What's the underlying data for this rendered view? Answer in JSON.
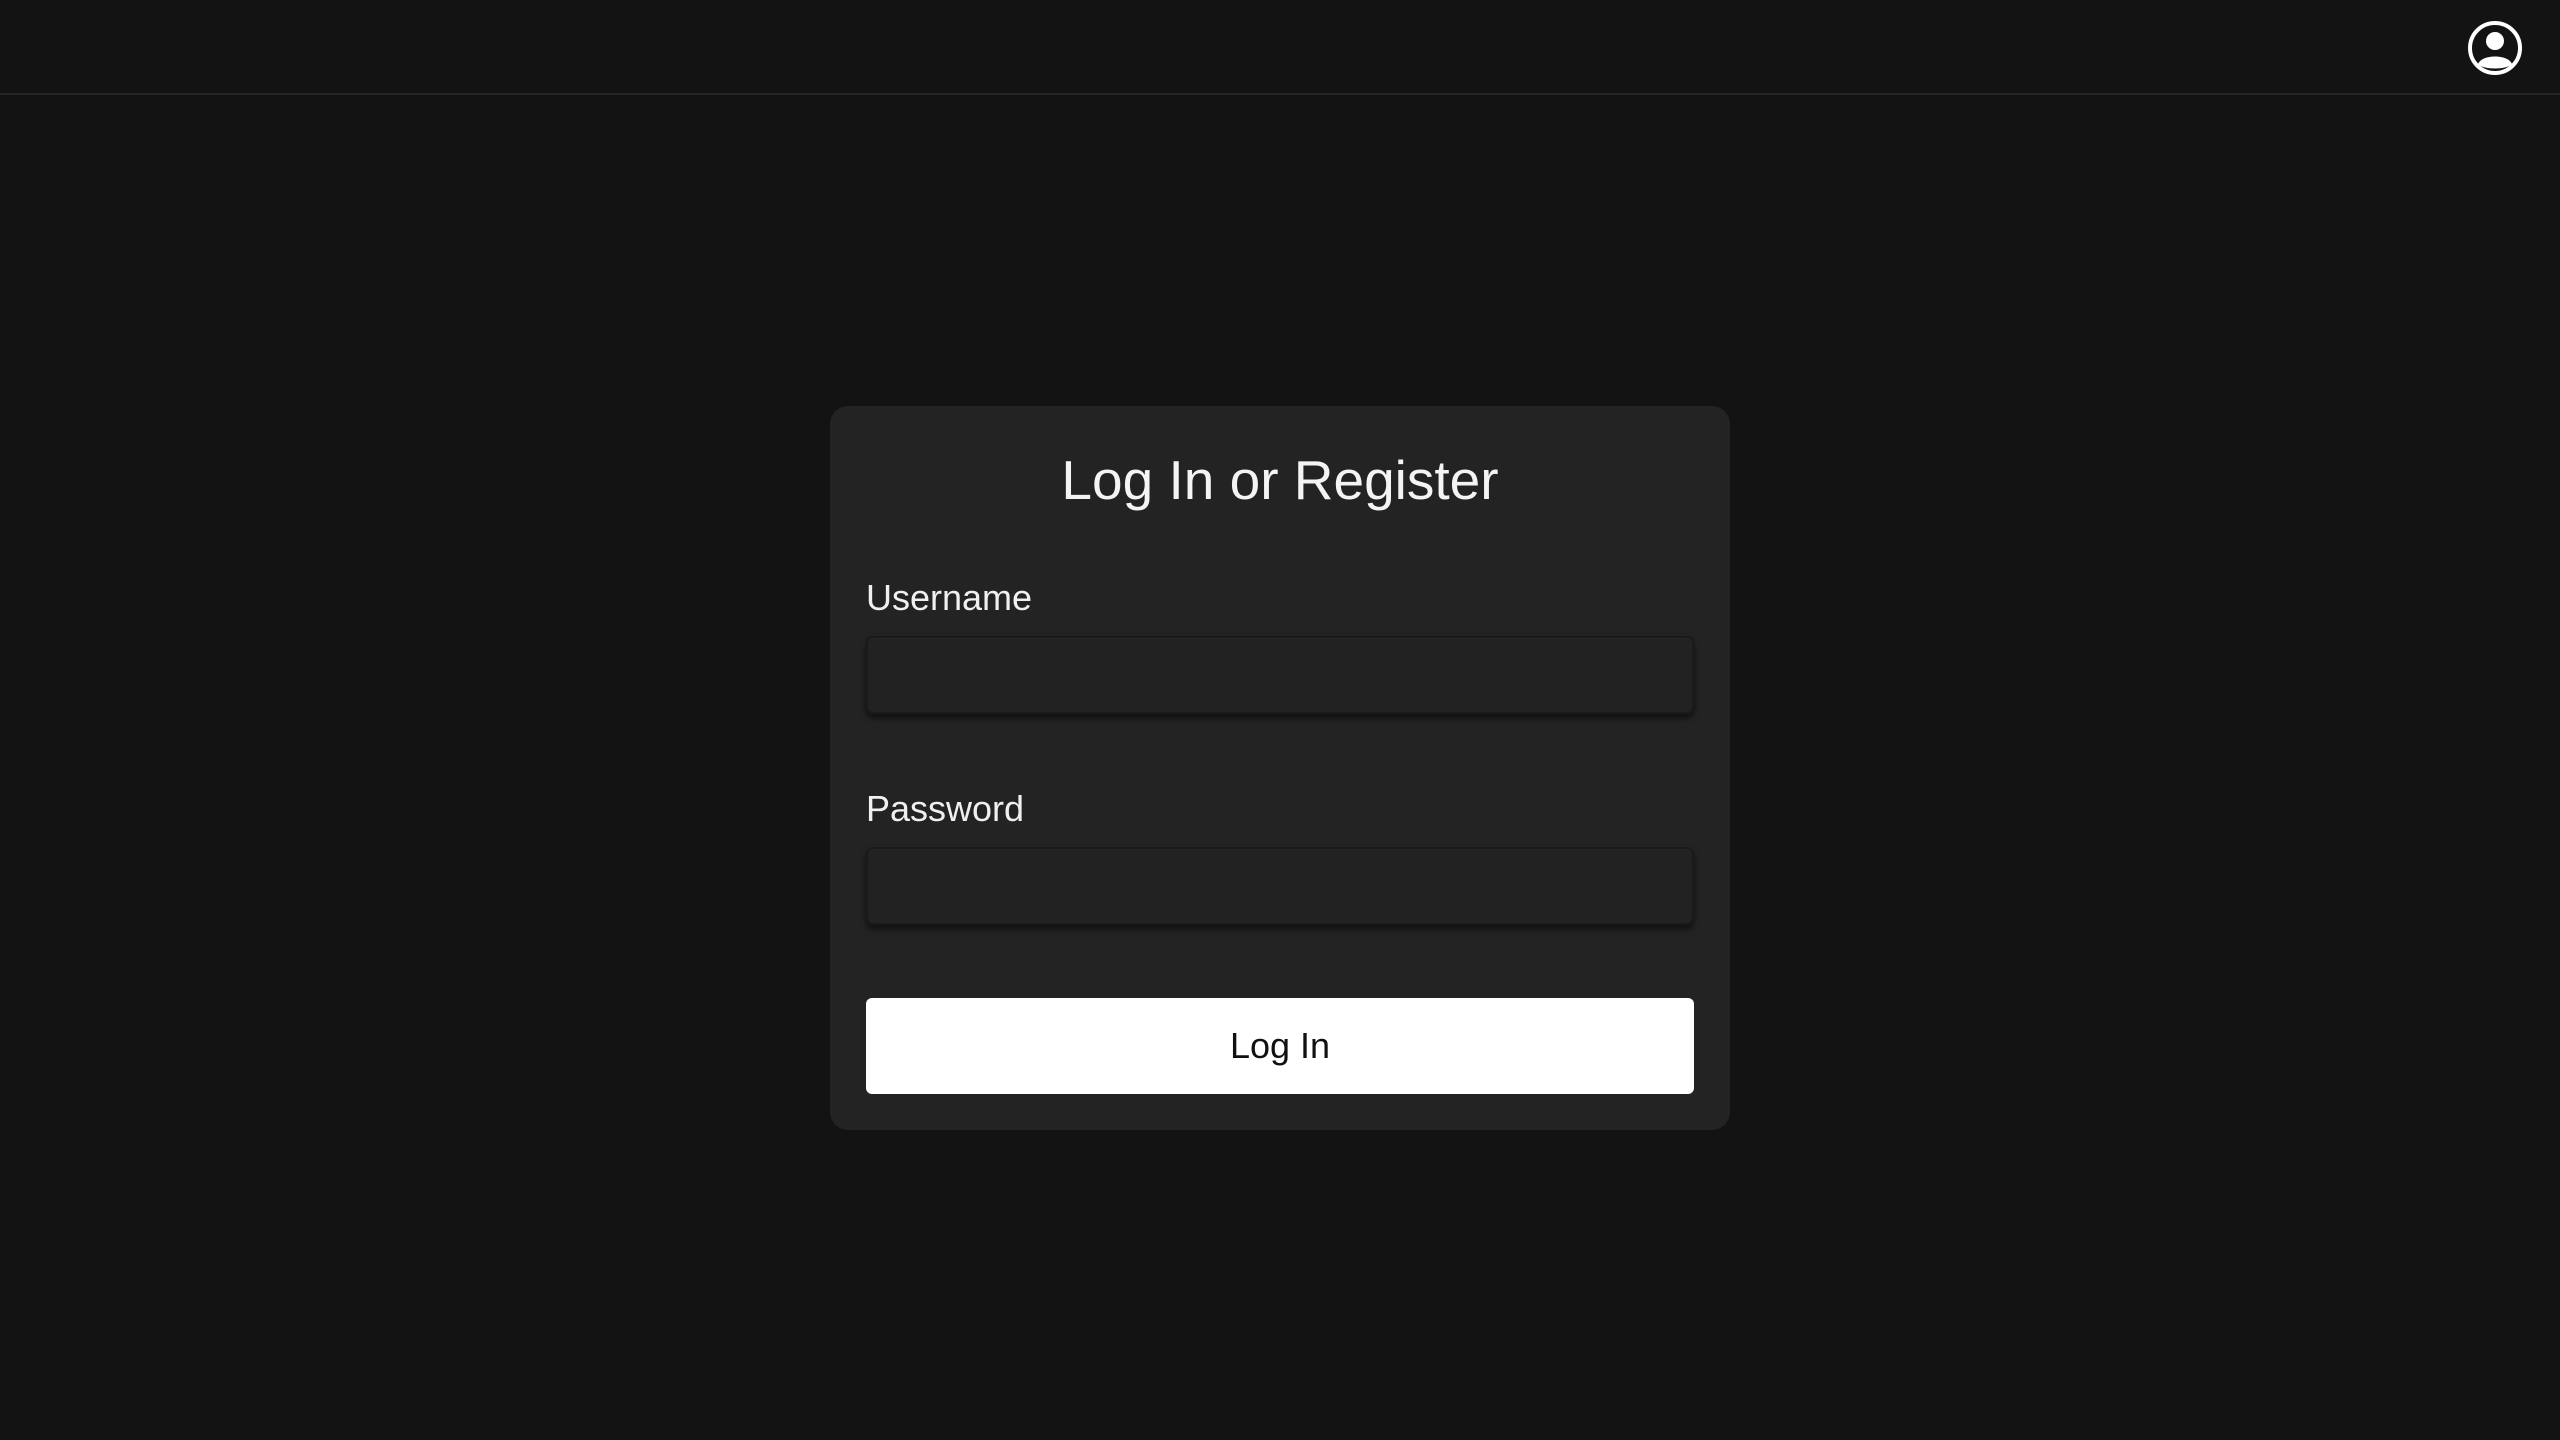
{
  "header": {
    "account_icon": "account-circle-icon"
  },
  "login_form": {
    "title": "Log In or Register",
    "username_label": "Username",
    "username_value": "",
    "password_label": "Password",
    "password_value": "",
    "submit_label": "Log In"
  },
  "colors": {
    "background": "#131313",
    "card": "#232323",
    "button": "#ffffff",
    "text": "#f2f2f2"
  }
}
